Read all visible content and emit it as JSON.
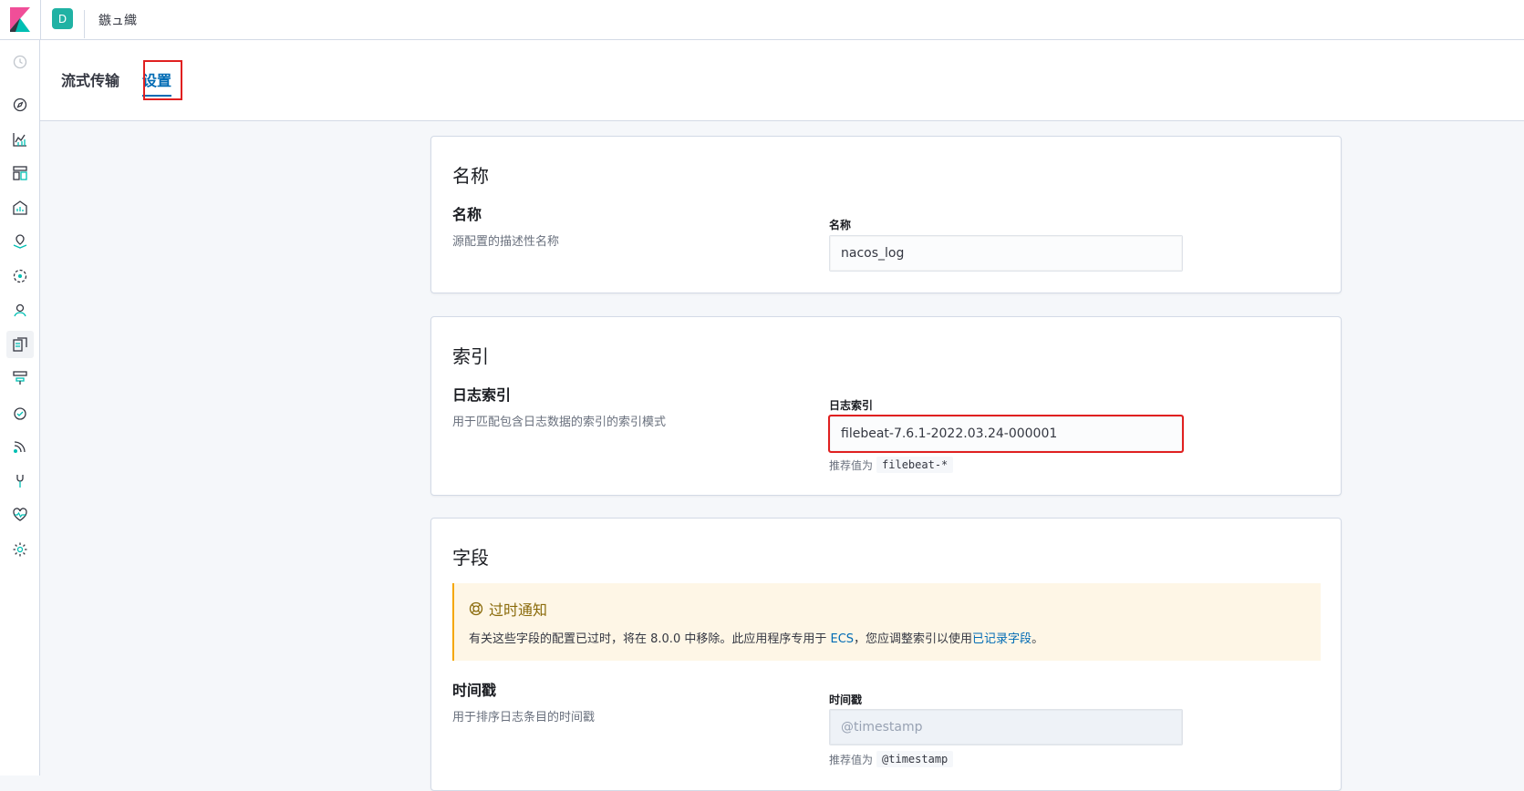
{
  "header": {
    "space_initial": "D",
    "breadcrumb": "鏃ュ織"
  },
  "sidenav": {
    "items": [
      "recently-viewed-icon",
      "discover-icon",
      "visualize-icon",
      "dashboard-icon",
      "canvas-icon",
      "maps-icon",
      "machine-learning-icon",
      "siem-icon",
      "logs-icon",
      "infrastructure-icon",
      "apm-icon",
      "uptime-icon",
      "dev-tools-icon",
      "stack-monitoring-icon",
      "management-icon"
    ],
    "active": "logs-icon"
  },
  "tabs": {
    "stream": "流式传输",
    "settings": "设置"
  },
  "sections": {
    "name": {
      "panel_title": "名称",
      "field_title": "名称",
      "description": "源配置的描述性名称",
      "label": "名称",
      "value": "nacos_log"
    },
    "index": {
      "panel_title": "索引",
      "field_title": "日志索引",
      "description": "用于匹配包含日志数据的索引的索引模式",
      "label": "日志索引",
      "value": "filebeat-7.6.1-2022.03.24-000001",
      "help_prefix": "推荐值为",
      "help_code": "filebeat-*"
    },
    "fields": {
      "panel_title": "字段",
      "callout_title": "过时通知",
      "callout_text_1": "有关这些字段的配置已过时，将在 8.0.0 中移除。此应用程序专用于",
      "callout_link_1": "ECS",
      "callout_text_2": "，您应调整索引以使用",
      "callout_link_2": "已记录字段",
      "callout_text_3": "。",
      "timestamp": {
        "field_title": "时间戳",
        "description": "用于排序日志条目的时间戳",
        "label": "时间戳",
        "placeholder": "@timestamp",
        "help_prefix": "推荐值为",
        "help_code": "@timestamp"
      }
    }
  },
  "colors": {
    "accent": "#006bb4",
    "highlight": "#e02020",
    "warning": "#f5a700"
  }
}
